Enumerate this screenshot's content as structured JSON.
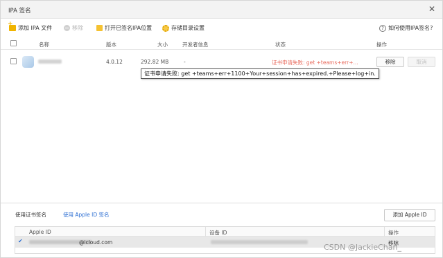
{
  "window": {
    "title": "IPA 签名",
    "close_glyph": "✕"
  },
  "toolbar": {
    "add_ipa": "添加 IPA 文件",
    "remove": "移除",
    "open_location": "打开已签名IPA位置",
    "storage_settings": "存储目录设置",
    "help": "如何使用IPA签名?",
    "help_glyph": "?"
  },
  "table": {
    "headers": {
      "name": "名称",
      "version": "版本",
      "size": "大小",
      "developer": "开发者信息",
      "status": "状态",
      "action": "操作"
    },
    "rows": [
      {
        "version": "4.0.12",
        "size": "292.82 MB",
        "developer": "-",
        "status": "证书申请失败: get +teams+err+...",
        "remove_label": "移除",
        "cancel_label": "取消"
      }
    ]
  },
  "tooltip": {
    "text": "证书申请失败: get +teams+err+1100+Your+session+has+expired.+Please+log+in."
  },
  "bottom": {
    "tab_cert": "使用证书签名",
    "tab_apple": "使用 Apple ID 签名",
    "add_apple_id": "添加 Apple ID",
    "headers": {
      "apple_id": "Apple ID",
      "device_id": "设备 ID",
      "action": "操作"
    },
    "rows": [
      {
        "check": "✔",
        "email_suffix": "@icloud.com",
        "action": "移除"
      }
    ]
  },
  "watermark": "CSDN @JackieChan_",
  "colors": {
    "error": "#e86a5c",
    "link": "#2d6fd3",
    "folder": "#f5c232"
  }
}
